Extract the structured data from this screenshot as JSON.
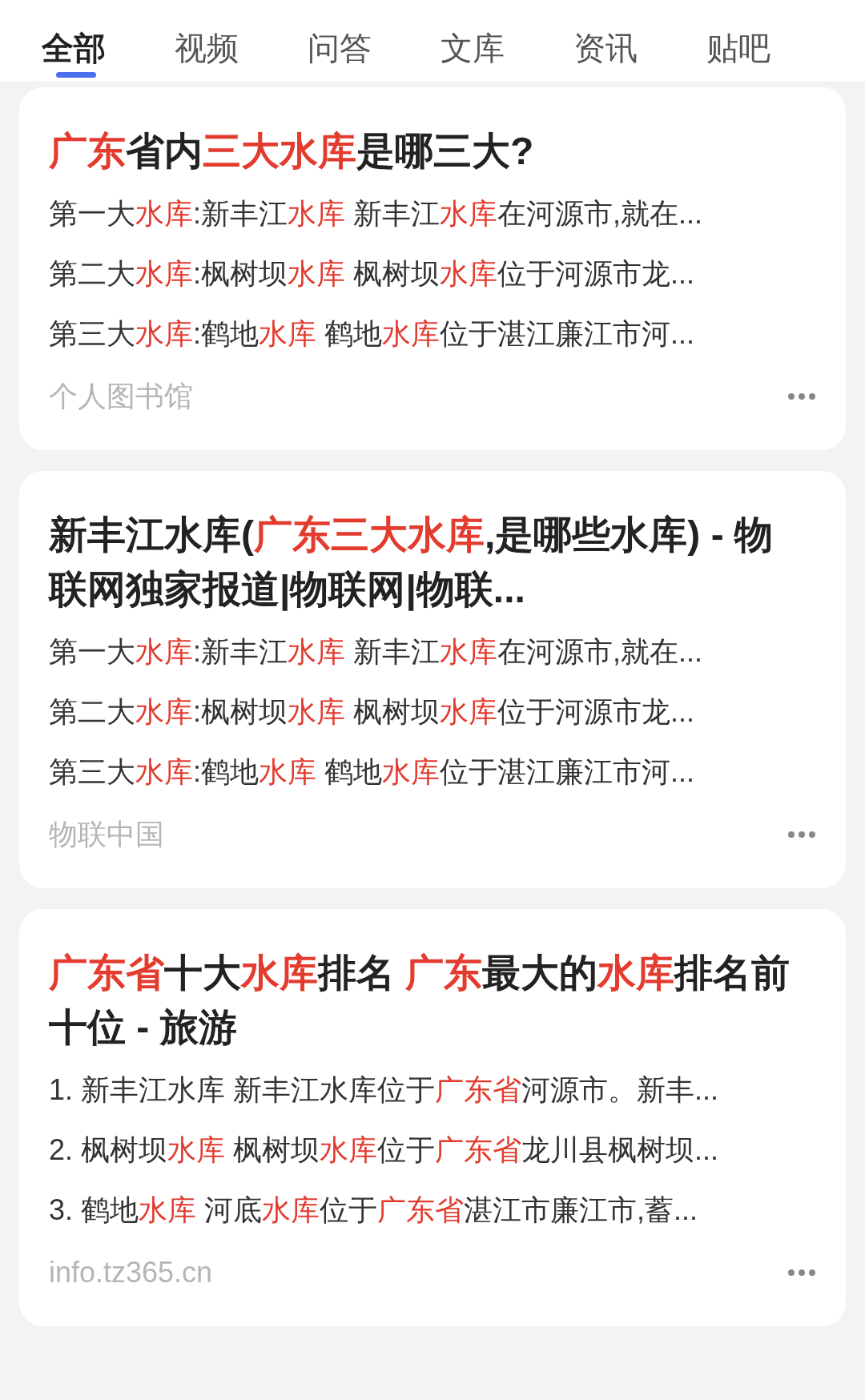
{
  "tabs": [
    {
      "label": "全部",
      "selected": true
    },
    {
      "label": "视频",
      "selected": false
    },
    {
      "label": "问答",
      "selected": false
    },
    {
      "label": "文库",
      "selected": false
    },
    {
      "label": "资讯",
      "selected": false
    },
    {
      "label": "贴吧",
      "selected": false
    }
  ],
  "results": [
    {
      "title": [
        {
          "text": "广东",
          "highlight": true
        },
        {
          "text": "省内",
          "highlight": false
        },
        {
          "text": "三大水库",
          "highlight": true
        },
        {
          "text": "是哪三大?",
          "highlight": false
        }
      ],
      "snippets": [
        [
          {
            "text": "第一大",
            "highlight": false
          },
          {
            "text": "水库",
            "highlight": true
          },
          {
            "text": ":新丰江",
            "highlight": false
          },
          {
            "text": "水库",
            "highlight": true
          },
          {
            "text": " 新丰江",
            "highlight": false
          },
          {
            "text": "水库",
            "highlight": true
          },
          {
            "text": "在河源市,就在...",
            "highlight": false
          }
        ],
        [
          {
            "text": "第二大",
            "highlight": false
          },
          {
            "text": "水库",
            "highlight": true
          },
          {
            "text": ":枫树坝",
            "highlight": false
          },
          {
            "text": "水库",
            "highlight": true
          },
          {
            "text": " 枫树坝",
            "highlight": false
          },
          {
            "text": "水库",
            "highlight": true
          },
          {
            "text": "位于河源市龙...",
            "highlight": false
          }
        ],
        [
          {
            "text": "第三大",
            "highlight": false
          },
          {
            "text": "水库",
            "highlight": true
          },
          {
            "text": ":鹤地",
            "highlight": false
          },
          {
            "text": "水库",
            "highlight": true
          },
          {
            "text": " 鹤地",
            "highlight": false
          },
          {
            "text": "水库",
            "highlight": true
          },
          {
            "text": "位于湛江廉江市河...",
            "highlight": false
          }
        ]
      ],
      "source": "个人图书馆"
    },
    {
      "title": [
        {
          "text": "新丰江水库(",
          "highlight": false
        },
        {
          "text": "广东三大水库",
          "highlight": true
        },
        {
          "text": ",是哪些水库) - 物联网独家报道|物联网|物联...",
          "highlight": false
        }
      ],
      "snippets": [
        [
          {
            "text": "第一大",
            "highlight": false
          },
          {
            "text": "水库",
            "highlight": true
          },
          {
            "text": ":新丰江",
            "highlight": false
          },
          {
            "text": "水库",
            "highlight": true
          },
          {
            "text": " 新丰江",
            "highlight": false
          },
          {
            "text": "水库",
            "highlight": true
          },
          {
            "text": "在河源市,就在...",
            "highlight": false
          }
        ],
        [
          {
            "text": "第二大",
            "highlight": false
          },
          {
            "text": "水库",
            "highlight": true
          },
          {
            "text": ":枫树坝",
            "highlight": false
          },
          {
            "text": "水库",
            "highlight": true
          },
          {
            "text": " 枫树坝",
            "highlight": false
          },
          {
            "text": "水库",
            "highlight": true
          },
          {
            "text": "位于河源市龙...",
            "highlight": false
          }
        ],
        [
          {
            "text": "第三大",
            "highlight": false
          },
          {
            "text": "水库",
            "highlight": true
          },
          {
            "text": ":鹤地",
            "highlight": false
          },
          {
            "text": "水库",
            "highlight": true
          },
          {
            "text": " 鹤地",
            "highlight": false
          },
          {
            "text": "水库",
            "highlight": true
          },
          {
            "text": "位于湛江廉江市河...",
            "highlight": false
          }
        ]
      ],
      "source": "物联中国"
    },
    {
      "title": [
        {
          "text": "广东省",
          "highlight": true
        },
        {
          "text": "十大",
          "highlight": false
        },
        {
          "text": "水库",
          "highlight": true
        },
        {
          "text": "排名 ",
          "highlight": false
        },
        {
          "text": "广东",
          "highlight": true
        },
        {
          "text": "最大的",
          "highlight": false
        },
        {
          "text": "水库",
          "highlight": true
        },
        {
          "text": "排名前十位 - 旅游",
          "highlight": false
        }
      ],
      "snippets": [
        [
          {
            "text": "1. 新丰江水库 新丰江水库位于",
            "highlight": false
          },
          {
            "text": "广东省",
            "highlight": true
          },
          {
            "text": "河源市。新丰...",
            "highlight": false
          }
        ],
        [
          {
            "text": "2. 枫树坝",
            "highlight": false
          },
          {
            "text": "水库",
            "highlight": true
          },
          {
            "text": " 枫树坝",
            "highlight": false
          },
          {
            "text": "水库",
            "highlight": true
          },
          {
            "text": "位于",
            "highlight": false
          },
          {
            "text": "广东省",
            "highlight": true
          },
          {
            "text": "龙川县枫树坝...",
            "highlight": false
          }
        ],
        [
          {
            "text": "3. 鹤地",
            "highlight": false
          },
          {
            "text": "水库",
            "highlight": true
          },
          {
            "text": " 河底",
            "highlight": false
          },
          {
            "text": "水库",
            "highlight": true
          },
          {
            "text": "位于",
            "highlight": false
          },
          {
            "text": "广东省",
            "highlight": true
          },
          {
            "text": "湛江市廉江市,蓄...",
            "highlight": false
          }
        ]
      ],
      "source": "info.tz365.cn"
    }
  ]
}
